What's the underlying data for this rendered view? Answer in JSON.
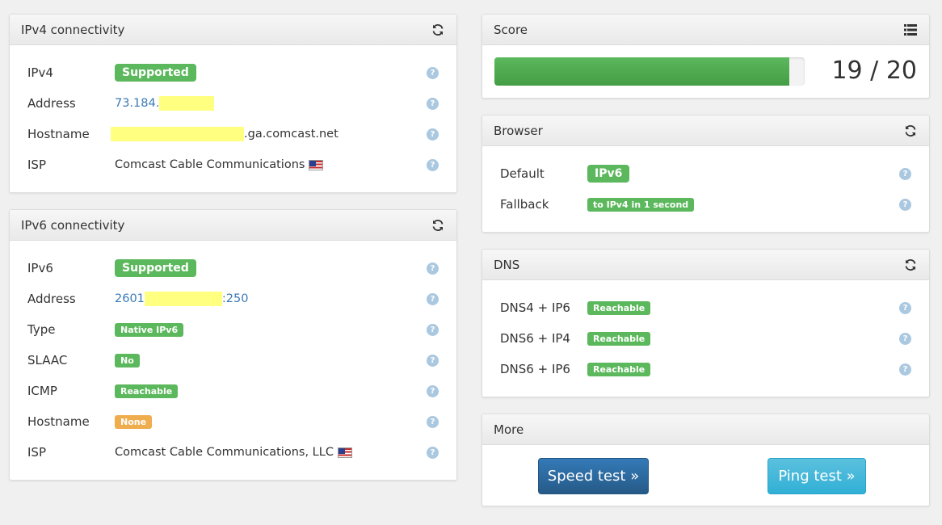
{
  "ipv4": {
    "title": "IPv4 connectivity",
    "rows": {
      "ipv4": {
        "label": "IPv4",
        "value": "Supported"
      },
      "address": {
        "label": "Address",
        "value": "73.184."
      },
      "hostname": {
        "label": "Hostname",
        "value": ".ga.comcast.net"
      },
      "isp": {
        "label": "ISP",
        "value": "Comcast Cable Communications"
      }
    }
  },
  "ipv6": {
    "title": "IPv6 connectivity",
    "rows": {
      "ipv6": {
        "label": "IPv6",
        "value": "Supported"
      },
      "address": {
        "label": "Address",
        "prefix": "2601",
        "suffix": ":250"
      },
      "type": {
        "label": "Type",
        "value": "Native IPv6"
      },
      "slaac": {
        "label": "SLAAC",
        "value": "No"
      },
      "icmp": {
        "label": "ICMP",
        "value": "Reachable"
      },
      "hostname": {
        "label": "Hostname",
        "value": "None"
      },
      "isp": {
        "label": "ISP",
        "value": "Comcast Cable Communications, LLC"
      }
    }
  },
  "score": {
    "title": "Score",
    "value": "19 / 20",
    "progress": 0.95
  },
  "browser": {
    "title": "Browser",
    "rows": {
      "default": {
        "label": "Default",
        "value": "IPv6"
      },
      "fallback": {
        "label": "Fallback",
        "value": "to IPv4 in 1 second"
      }
    }
  },
  "dns": {
    "title": "DNS",
    "rows": {
      "dns4ip6": {
        "label": "DNS4 + IP6",
        "value": "Reachable"
      },
      "dns6ip4": {
        "label": "DNS6 + IP4",
        "value": "Reachable"
      },
      "dns6ip6": {
        "label": "DNS6 + IP6",
        "value": "Reachable"
      }
    }
  },
  "more": {
    "title": "More",
    "speed_test": "Speed test »",
    "ping_test": "Ping test »"
  },
  "help_glyph": "?",
  "colors": {
    "success": "#5cb85c",
    "warning": "#f0ad4e",
    "primary": "#337ab7",
    "info": "#5bc0de",
    "link": "#3a7ab7",
    "redaction": "#ffff80"
  }
}
